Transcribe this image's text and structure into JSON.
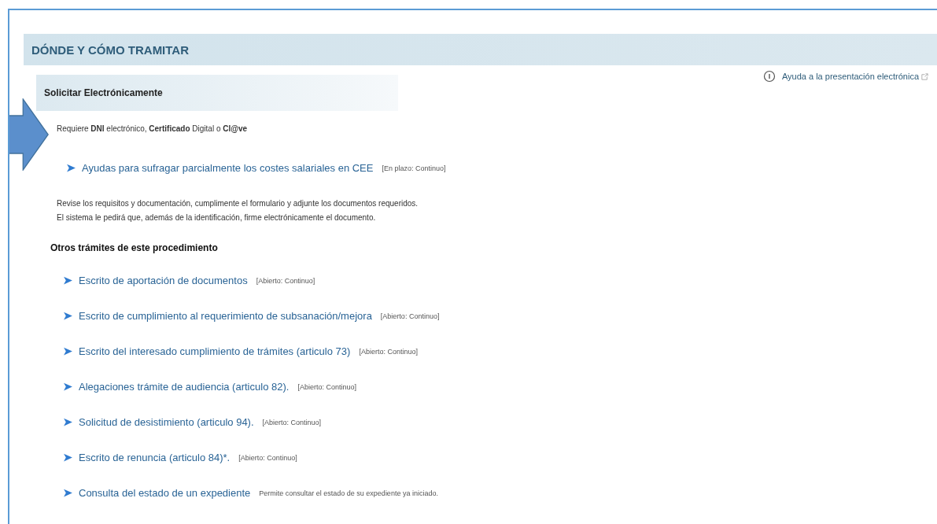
{
  "section_title": "DÓNDE Y CÓMO TRAMITAR",
  "help_link": {
    "label": "Ayuda a la presentación electrónica"
  },
  "subsection_title": "Solicitar Electrónicamente",
  "requirement": "Requiere **DNI** electrónico, **Certificado** Digital o **Cl@ve**",
  "main_procedure": {
    "label": "Ayudas para sufragar parcialmente los costes salariales en CEE",
    "note": "[En plazo: Continuo]"
  },
  "instructions": [
    "Revise los requisitos y documentación, cumplimente el formulario y adjunte los documentos requeridos.",
    "El sistema le pedirá que, además de la identificación, firme electrónicamente el documento."
  ],
  "other_title": "Otros trámites de este procedimiento",
  "other_procedures": [
    {
      "label": "Escrito de aportación de documentos",
      "note": "[Abierto: Continuo]"
    },
    {
      "label": "Escrito de cumplimiento al requerimiento de subsanación/mejora",
      "note": "[Abierto: Continuo]"
    },
    {
      "label": "Escrito del interesado cumplimiento de trámites (articulo 73)",
      "note": "[Abierto: Continuo]"
    },
    {
      "label": "Alegaciones trámite de audiencia (articulo 82).",
      "note": "[Abierto: Continuo]"
    },
    {
      "label": "Solicitud de desistimiento (articulo 94).",
      "note": "[Abierto: Continuo]"
    },
    {
      "label": "Escrito de renuncia (articulo 84)*.",
      "note": "[Abierto: Continuo]"
    },
    {
      "label": "Consulta del estado de un expediente",
      "note": "Permite consultar el estado de su expediente ya iniciado."
    }
  ]
}
